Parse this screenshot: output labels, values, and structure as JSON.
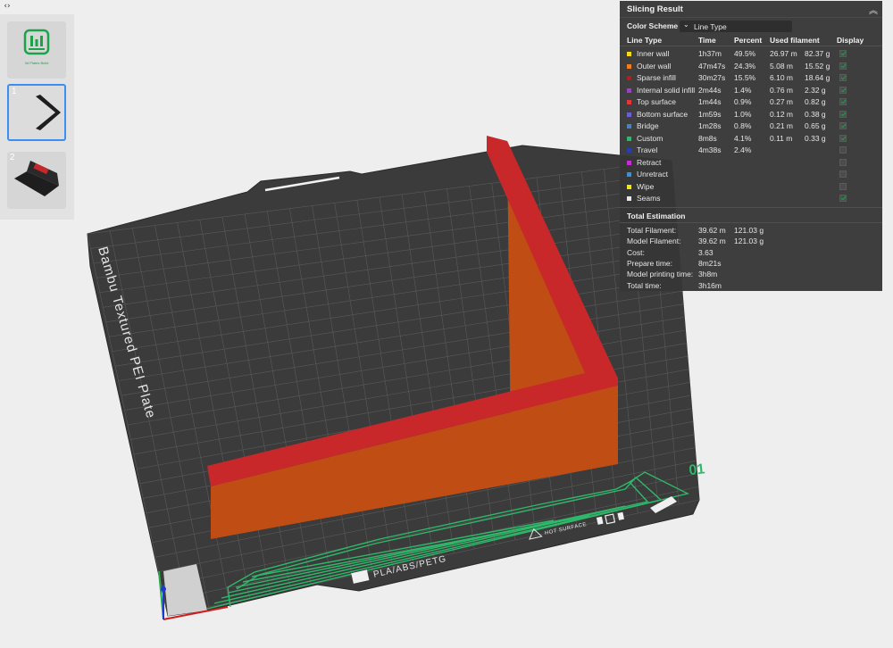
{
  "plate_list": {
    "collapse_icon": "expand-collapse-icon",
    "plates": [
      {
        "number": "",
        "caption": "3d Plates Build",
        "icon": "bambu-logo-icon"
      },
      {
        "number": "1",
        "caption": "",
        "icon": "l-bracket-model-thumbnail"
      },
      {
        "number": "2",
        "caption": "",
        "icon": "bracket-model-thumbnail"
      }
    ]
  },
  "viewport": {
    "plate_name": "Bambu Textured PEI Plate",
    "plate_number": "01",
    "filament_label": "PLA/ABS/PETG",
    "hot_surface_label": "HOT SURFACE",
    "colors": {
      "bed": "#3b3b3b",
      "grid": "#5a5a5a",
      "model_side": "#c04e14",
      "model_top": "#c8282a",
      "custom_gcode": "#2fb86a"
    }
  },
  "slicing_result": {
    "title": "Slicing Result",
    "color_scheme_label": "Color Scheme",
    "color_scheme_value": "Line Type",
    "headers": {
      "line_type": "Line Type",
      "time": "Time",
      "percent": "Percent",
      "used_filament": "Used filament",
      "display": "Display"
    },
    "rows": [
      {
        "name": "Inner wall",
        "time": "1h37m",
        "percent": "49.5%",
        "meters": "26.97 m",
        "grams": "82.37 g",
        "color": "#f5d91a",
        "display": true
      },
      {
        "name": "Outer wall",
        "time": "47m47s",
        "percent": "24.3%",
        "meters": "5.08 m",
        "grams": "15.52 g",
        "color": "#f07d1f",
        "display": true
      },
      {
        "name": "Sparse infill",
        "time": "30m27s",
        "percent": "15.5%",
        "meters": "6.10 m",
        "grams": "18.64 g",
        "color": "#a8231f",
        "display": true
      },
      {
        "name": "Internal solid infill",
        "time": "2m44s",
        "percent": "1.4%",
        "meters": "0.76 m",
        "grams": "2.32 g",
        "color": "#9a3fc9",
        "display": true
      },
      {
        "name": "Top surface",
        "time": "1m44s",
        "percent": "0.9%",
        "meters": "0.27 m",
        "grams": "0.82 g",
        "color": "#e2363b",
        "display": true
      },
      {
        "name": "Bottom surface",
        "time": "1m59s",
        "percent": "1.0%",
        "meters": "0.12 m",
        "grams": "0.38 g",
        "color": "#6b5fd1",
        "display": true
      },
      {
        "name": "Bridge",
        "time": "1m28s",
        "percent": "0.8%",
        "meters": "0.21 m",
        "grams": "0.65 g",
        "color": "#4d82b8",
        "display": true
      },
      {
        "name": "Custom",
        "time": "8m8s",
        "percent": "4.1%",
        "meters": "0.11 m",
        "grams": "0.33 g",
        "color": "#2fb86a",
        "display": true
      },
      {
        "name": "Travel",
        "time": "4m38s",
        "percent": "2.4%",
        "meters": "",
        "grams": "",
        "color": "#2a3fa8",
        "display": false
      },
      {
        "name": "Retract",
        "time": "",
        "percent": "",
        "meters": "",
        "grams": "",
        "color": "#c42fd1",
        "display": false
      },
      {
        "name": "Unretract",
        "time": "",
        "percent": "",
        "meters": "",
        "grams": "",
        "color": "#3d8fd6",
        "display": false
      },
      {
        "name": "Wipe",
        "time": "",
        "percent": "",
        "meters": "",
        "grams": "",
        "color": "#f0e516",
        "display": false
      },
      {
        "name": "Seams",
        "time": "",
        "percent": "",
        "meters": "",
        "grams": "",
        "color": "#e8e8e8",
        "display": true
      }
    ],
    "total_estimation": {
      "title": "Total Estimation",
      "items": [
        {
          "label": "Total Filament:",
          "value1": "39.62 m",
          "value2": "121.03 g"
        },
        {
          "label": "Model Filament:",
          "value1": "39.62 m",
          "value2": "121.03 g"
        },
        {
          "label": "Cost:",
          "value1": "3.63",
          "value2": ""
        },
        {
          "label": "Prepare time:",
          "value1": "8m21s",
          "value2": ""
        },
        {
          "label": "Model printing time:",
          "value1": "3h8m",
          "value2": ""
        },
        {
          "label": "Total time:",
          "value1": "3h16m",
          "value2": ""
        }
      ]
    }
  }
}
